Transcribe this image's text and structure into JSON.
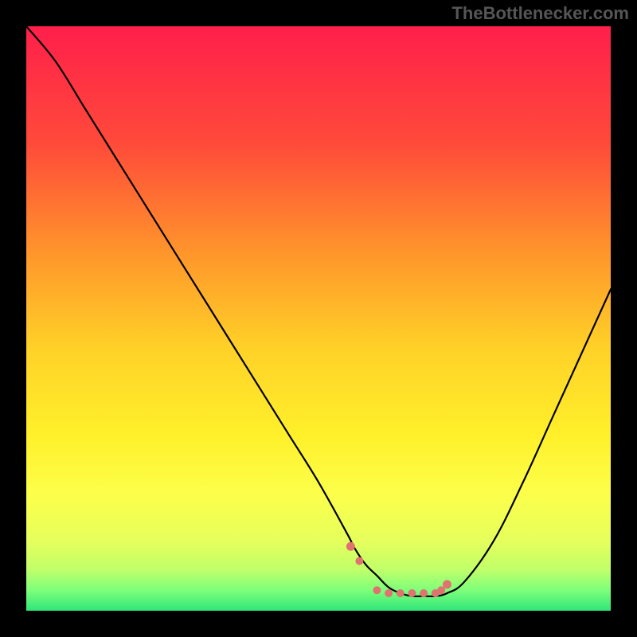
{
  "watermark": "TheBottlenecker.com",
  "chart_data": {
    "type": "line",
    "title": "",
    "xlabel": "",
    "ylabel": "",
    "xlim": [
      0,
      100
    ],
    "ylim": [
      0,
      100
    ],
    "x": [
      0,
      5,
      10,
      15,
      20,
      25,
      30,
      35,
      40,
      45,
      50,
      55,
      56,
      58,
      60,
      62,
      64,
      66,
      68,
      70,
      72,
      75,
      80,
      85,
      90,
      95,
      100
    ],
    "values": [
      100,
      94,
      86,
      78,
      70,
      62,
      54,
      46,
      38,
      30,
      22,
      13,
      11,
      8,
      6,
      4,
      3,
      2.5,
      2.5,
      2.5,
      3,
      5,
      12,
      22,
      33,
      44,
      55
    ],
    "highlight_points_x": [
      55.5,
      57,
      60,
      62,
      64,
      66,
      68,
      70,
      71,
      72
    ],
    "highlight_points_y": [
      11,
      8.5,
      3.5,
      3,
      3,
      3,
      3,
      3,
      3.5,
      4.5
    ],
    "gradient_stops": [
      {
        "pos": 0.0,
        "color": "#ff1f4b"
      },
      {
        "pos": 0.2,
        "color": "#ff4a3a"
      },
      {
        "pos": 0.4,
        "color": "#ff9a2a"
      },
      {
        "pos": 0.55,
        "color": "#ffd128"
      },
      {
        "pos": 0.7,
        "color": "#fff02a"
      },
      {
        "pos": 0.8,
        "color": "#fcff4a"
      },
      {
        "pos": 0.88,
        "color": "#e6ff5c"
      },
      {
        "pos": 0.93,
        "color": "#c0ff6a"
      },
      {
        "pos": 0.965,
        "color": "#7dff7a"
      },
      {
        "pos": 1.0,
        "color": "#2fe67a"
      }
    ]
  }
}
